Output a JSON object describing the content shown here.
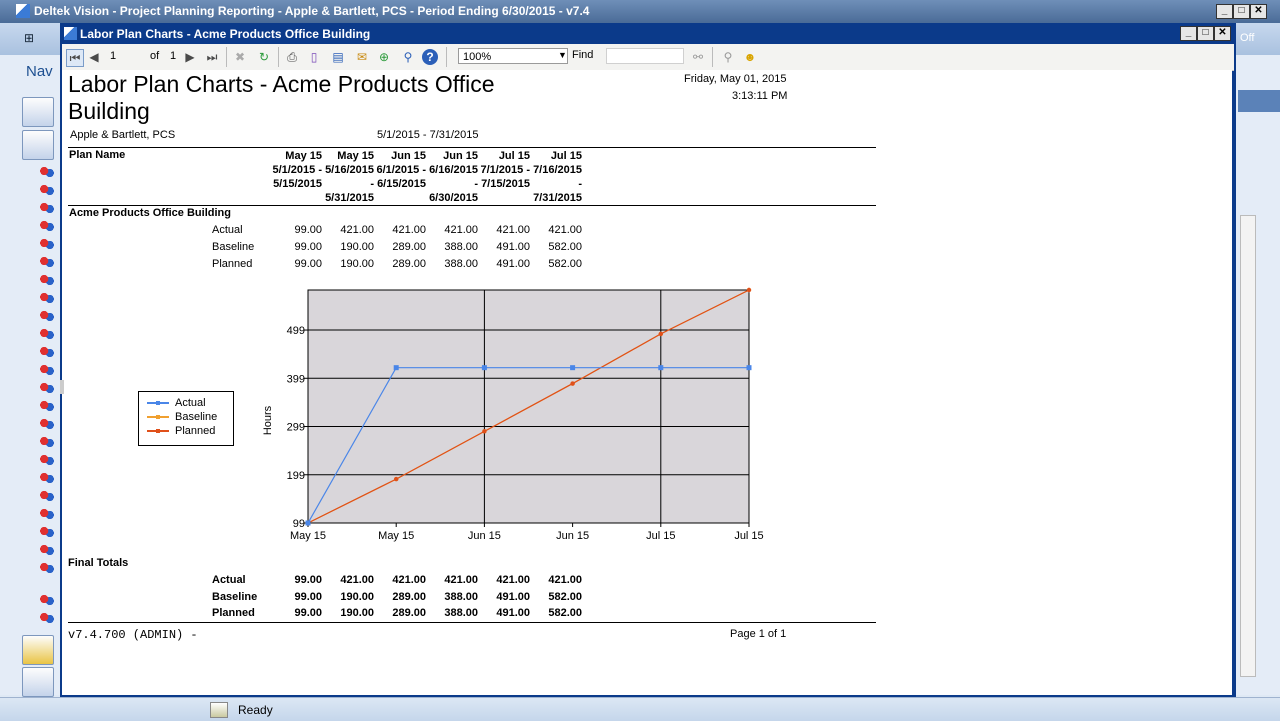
{
  "app": {
    "title": "Deltek Vision - Project Planning Reporting - Apple & Bartlett, PCS - Period Ending 6/30/2015 - v7.4",
    "nav_label": "Nav",
    "off_label": "Off",
    "status": "Ready"
  },
  "report_window": {
    "title": "Labor Plan Charts - Acme Products Office Building"
  },
  "toolbar": {
    "page_value": "1",
    "of_label": "of",
    "total_pages": "1",
    "zoom": "100%",
    "find_label": "Find"
  },
  "report": {
    "title_line1": "Labor Plan Charts - Acme Products Office",
    "title_line2": "Building",
    "company": "Apple & Bartlett, PCS",
    "date_range": "5/1/2015 - 7/31/2015",
    "run_date": "Friday, May 01, 2015",
    "run_time": "3:13:11 PM",
    "plan_name_header": "Plan Name",
    "columns": [
      {
        "period": "May 15",
        "l1": "5/1/2015 -",
        "l2": "5/15/2015",
        "l3": ""
      },
      {
        "period": "May 15",
        "l1": "5/16/2015",
        "l2": "-",
        "l3": "5/31/2015"
      },
      {
        "period": "Jun 15",
        "l1": "6/1/2015 -",
        "l2": "6/15/2015",
        "l3": ""
      },
      {
        "period": "Jun 15",
        "l1": "6/16/2015",
        "l2": "-",
        "l3": "6/30/2015"
      },
      {
        "period": "Jul 15",
        "l1": "7/1/2015 -",
        "l2": "7/15/2015",
        "l3": ""
      },
      {
        "period": "Jul 15",
        "l1": "7/16/2015",
        "l2": "-",
        "l3": "7/31/2015"
      }
    ],
    "project_name": "Acme Products Office Building",
    "rows": [
      {
        "label": "Actual",
        "values": [
          "99.00",
          "421.00",
          "421.00",
          "421.00",
          "421.00",
          "421.00"
        ]
      },
      {
        "label": "Baseline",
        "values": [
          "99.00",
          "190.00",
          "289.00",
          "388.00",
          "491.00",
          "582.00"
        ]
      },
      {
        "label": "Planned",
        "values": [
          "99.00",
          "190.00",
          "289.00",
          "388.00",
          "491.00",
          "582.00"
        ]
      }
    ],
    "final_totals_label": "Final Totals",
    "totals": [
      {
        "label": "Actual",
        "values": [
          "99.00",
          "421.00",
          "421.00",
          "421.00",
          "421.00",
          "421.00"
        ]
      },
      {
        "label": "Baseline",
        "values": [
          "99.00",
          "190.00",
          "289.00",
          "388.00",
          "491.00",
          "582.00"
        ]
      },
      {
        "label": "Planned",
        "values": [
          "99.00",
          "190.00",
          "289.00",
          "388.00",
          "491.00",
          "582.00"
        ]
      }
    ],
    "footer_version": "v7.4.700 (ADMIN) -",
    "footer_page": "Page 1 of 1"
  },
  "chart_data": {
    "type": "line",
    "categories": [
      "May 15",
      "May 15",
      "Jun 15",
      "Jun 15",
      "Jul 15",
      "Jul 15"
    ],
    "series": [
      {
        "name": "Actual",
        "color": "#4a86e8",
        "values": [
          99,
          421,
          421,
          421,
          421,
          421
        ]
      },
      {
        "name": "Baseline",
        "color": "#f0a030",
        "values": [
          99,
          190,
          289,
          388,
          491,
          582
        ]
      },
      {
        "name": "Planned",
        "color": "#e0501a",
        "values": [
          99,
          190,
          289,
          388,
          491,
          582
        ]
      }
    ],
    "ylabel": "Hours",
    "yticks": [
      99,
      199,
      299,
      399,
      499
    ],
    "ylim": [
      99,
      582
    ],
    "grid": true,
    "plot_background": "#d9d6da",
    "legend_position": "left"
  }
}
